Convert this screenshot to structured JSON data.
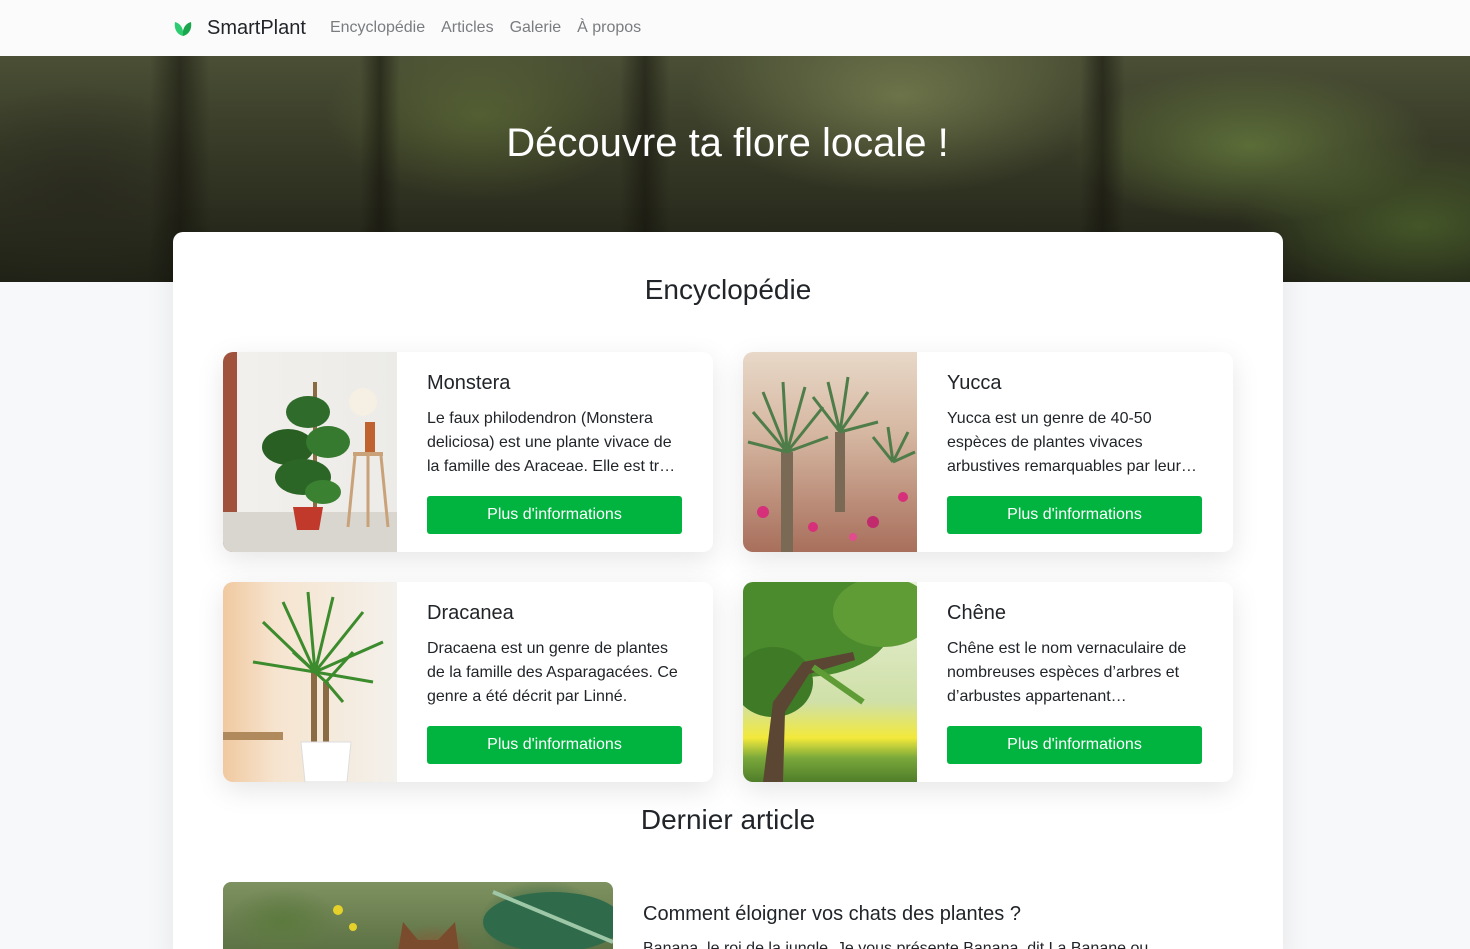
{
  "navbar": {
    "brand": "SmartPlant",
    "links": [
      {
        "label": "Encyclopédie"
      },
      {
        "label": "Articles"
      },
      {
        "label": "Galerie"
      },
      {
        "label": "À propos"
      }
    ]
  },
  "hero": {
    "title": "Découvre ta flore locale !"
  },
  "encyclopedia": {
    "title": "Encyclopédie",
    "cards": [
      {
        "name": "Monstera",
        "description": "Le faux philodendron (Monstera deliciosa) est une plante vivace de la famille des Araceae. Elle est très appréciée comme plante d'intérieur.",
        "button": "Plus d'informations"
      },
      {
        "name": "Yucca",
        "description": "Yucca est un genre de 40-50 espèces de plantes vivaces arbustives remarquables par leurs rosettes de feuilles.",
        "button": "Plus d'informations"
      },
      {
        "name": "Dracanea",
        "description": "Dracaena est un genre de plantes de la famille des Asparagacées. Ce genre a été décrit par Linné.",
        "button": "Plus d'informations"
      },
      {
        "name": "Chêne",
        "description": "Chêne est le nom vernaculaire de nombreuses espèces d’arbres et d’arbustes appartenant…",
        "button": "Plus d'informations"
      }
    ]
  },
  "latest_article": {
    "title": "Dernier article",
    "article_title": "Comment éloigner vos chats des plantes ?",
    "excerpt": "Banana, le roi de la jungle. Je vous présente Banana, dit La Banane ou"
  },
  "colors": {
    "accent": "#00b43f",
    "brand_leaf": "#1db954"
  }
}
